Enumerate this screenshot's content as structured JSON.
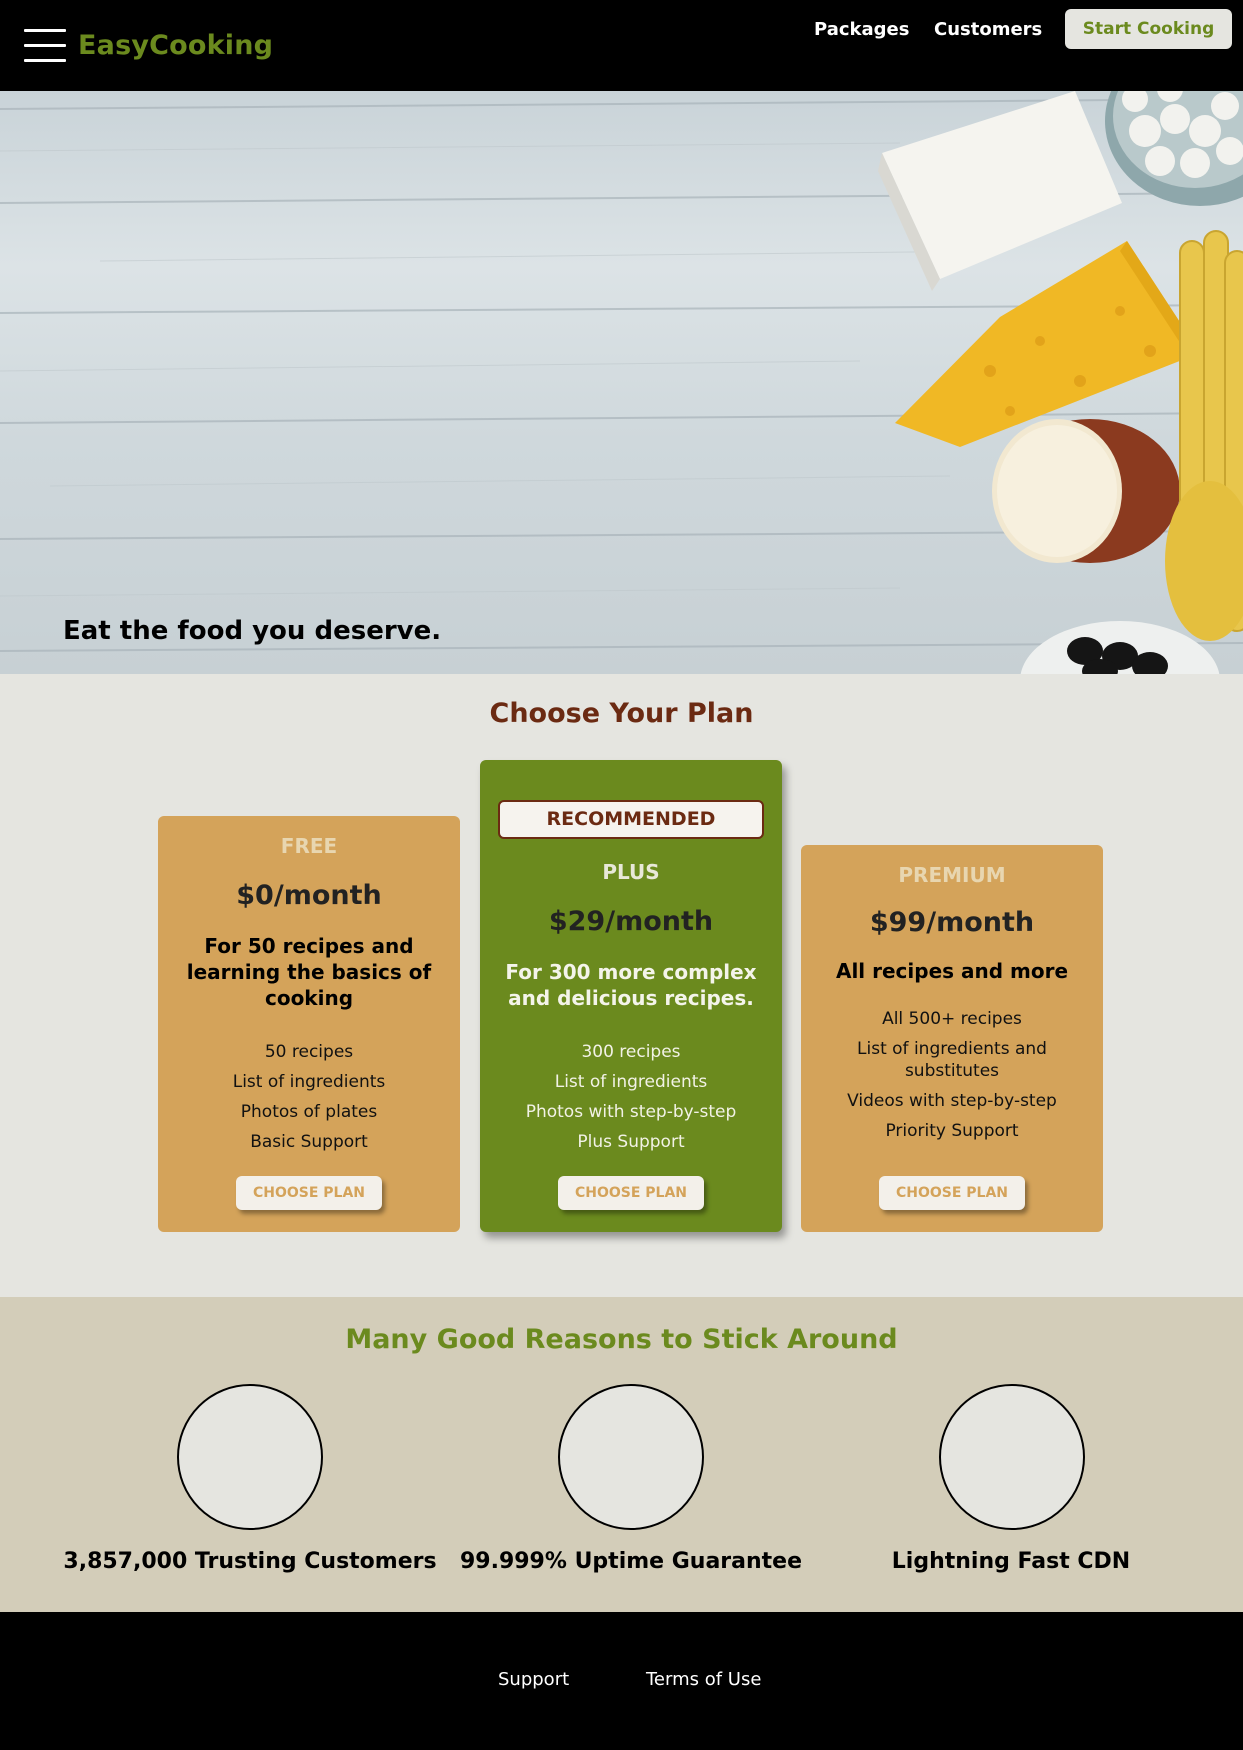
{
  "header": {
    "logo": "EasyCooking",
    "menu_icon": "hamburger-menu-icon",
    "nav": [
      {
        "label": "Packages"
      },
      {
        "label": "Customers"
      }
    ],
    "cta_label": "Start Cooking"
  },
  "hero": {
    "tagline": "Eat the food you deserve."
  },
  "pricing": {
    "title": "Choose Your Plan",
    "plans": [
      {
        "tier": "FREE",
        "price": "$0/month",
        "description": "For 50 recipes and learning the basics of cooking",
        "features": [
          "50 recipes",
          "List of ingredients",
          "Photos of plates",
          "Basic Support"
        ],
        "button": "CHOOSE PLAN"
      },
      {
        "badge": "RECOMMENDED",
        "tier": "PLUS",
        "price": "$29/month",
        "description": "For 300 more complex and delicious recipes.",
        "features": [
          "300 recipes",
          "List of ingredients",
          "Photos with step-by-step",
          "Plus Support"
        ],
        "button": "CHOOSE PLAN"
      },
      {
        "tier": "PREMIUM",
        "price": "$99/month",
        "description": "All recipes and more",
        "features": [
          "All 500+ recipes",
          "List of ingredients and substitutes",
          "Videos with step-by-step",
          "Priority Support"
        ],
        "button": "CHOOSE PLAN"
      }
    ]
  },
  "reasons": {
    "title": "Many Good Reasons to Stick Around",
    "items": [
      {
        "label": "3,857,000 Trusting Customers"
      },
      {
        "label": "99.999% Uptime Guarantee"
      },
      {
        "label": "Lightning Fast CDN"
      }
    ]
  },
  "footer": {
    "links": [
      {
        "label": "Support"
      },
      {
        "label": "Terms of Use"
      }
    ]
  },
  "colors": {
    "brand_green": "#6b8a1e",
    "accent_orange": "#d4a35a",
    "title_brown": "#6b2a12"
  }
}
